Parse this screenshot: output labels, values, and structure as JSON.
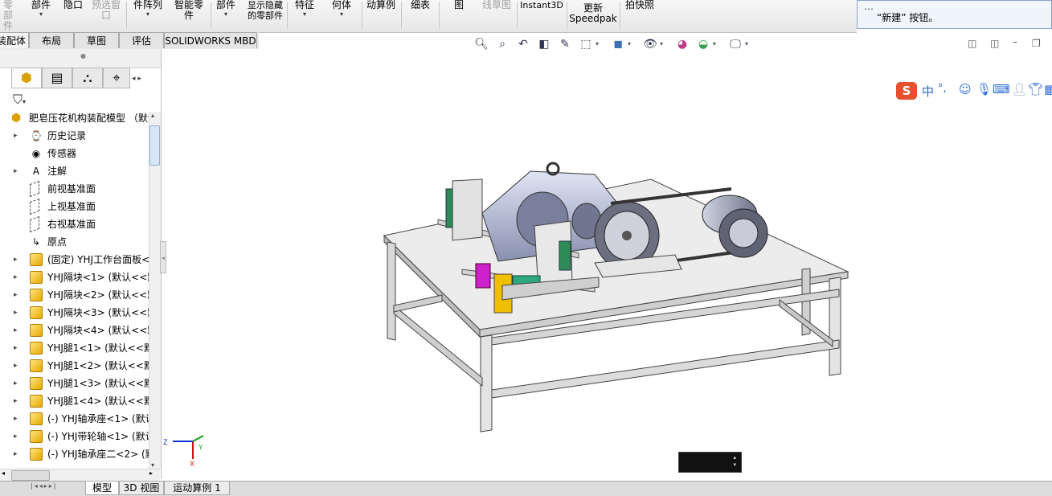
{
  "ribbon": {
    "items": [
      {
        "label": "零\n部件",
        "disabled": true
      },
      {
        "label": "部件"
      },
      {
        "label": "隐口"
      },
      {
        "label": "预选窗口",
        "disabled": true
      },
      {
        "label": "件阵列"
      },
      {
        "label": "智能零件"
      },
      {
        "label": "部件"
      },
      {
        "label": "显示隐藏的零部件"
      },
      {
        "label": "特征"
      },
      {
        "label": "何体"
      },
      {
        "label": "动算例"
      },
      {
        "label": "细表"
      },
      {
        "label": "图"
      },
      {
        "label": "线草图",
        "disabled": true
      },
      {
        "label": "Instant3D"
      },
      {
        "label": "更新\nSpeedpak"
      },
      {
        "label": "拍快照"
      }
    ]
  },
  "notification": {
    "line1": "…",
    "line2": "“新建” 按钮。"
  },
  "command_tabs": [
    {
      "label": "装配体",
      "active": true
    },
    {
      "label": "布局"
    },
    {
      "label": "草图"
    },
    {
      "label": "评估"
    },
    {
      "label": "SOLIDWORKS MBD"
    }
  ],
  "tree": {
    "root": "肥皂压花机构装配模型 （默认",
    "items": [
      {
        "label": "历史记录",
        "icon": "history-icon",
        "expand": true
      },
      {
        "label": "传感器",
        "icon": "sensor-icon",
        "expand": false
      },
      {
        "label": "注解",
        "icon": "annotation-icon",
        "expand": true
      },
      {
        "label": "前视基准面",
        "icon": "plane-icon",
        "expand": false
      },
      {
        "label": "上视基准面",
        "icon": "plane-icon",
        "expand": false
      },
      {
        "label": "右视基准面",
        "icon": "plane-icon",
        "expand": false
      },
      {
        "label": "原点",
        "icon": "origin-icon",
        "expand": false
      },
      {
        "label": "(固定) YHJ工作台面板<",
        "icon": "part-icon",
        "expand": true
      },
      {
        "label": "YHJ隔块<1> (默认<<默",
        "icon": "part-icon",
        "expand": true
      },
      {
        "label": "YHJ隔块<2> (默认<<默",
        "icon": "part-icon",
        "expand": true
      },
      {
        "label": "YHJ隔块<3> (默认<<默",
        "icon": "part-icon",
        "expand": true
      },
      {
        "label": "YHJ隔块<4> (默认<<默",
        "icon": "part-icon",
        "expand": true
      },
      {
        "label": "YHJ腿1<1> (默认<<默",
        "icon": "part-icon",
        "expand": true
      },
      {
        "label": "YHJ腿1<2> (默认<<默",
        "icon": "part-icon",
        "expand": true
      },
      {
        "label": "YHJ腿1<3> (默认<<默",
        "icon": "part-icon",
        "expand": true
      },
      {
        "label": "YHJ腿1<4> (默认<<默",
        "icon": "part-icon",
        "expand": true
      },
      {
        "label": "(-) YHJ轴承座<1> (默认",
        "icon": "part-icon",
        "expand": true
      },
      {
        "label": "(-) YHJ带轮轴<1> (默认",
        "icon": "part-icon",
        "expand": true
      },
      {
        "label": "(-) YHJ轴承座二<2> (默",
        "icon": "part-icon",
        "expand": true
      }
    ]
  },
  "triad": {
    "x": "X",
    "y": "Y",
    "z": "Z"
  },
  "bottom_tabs": [
    {
      "label": "模型",
      "active": true
    },
    {
      "label": "3D 视图"
    },
    {
      "label": "运动算例 1"
    }
  ],
  "ime": {
    "brand": "S",
    "mode": "中",
    "punct": "°,"
  },
  "colors": {
    "accent_blue": "#2a6bd6",
    "ribbon_bg": "#eeeeee",
    "part_yellow": "#f0c000"
  }
}
